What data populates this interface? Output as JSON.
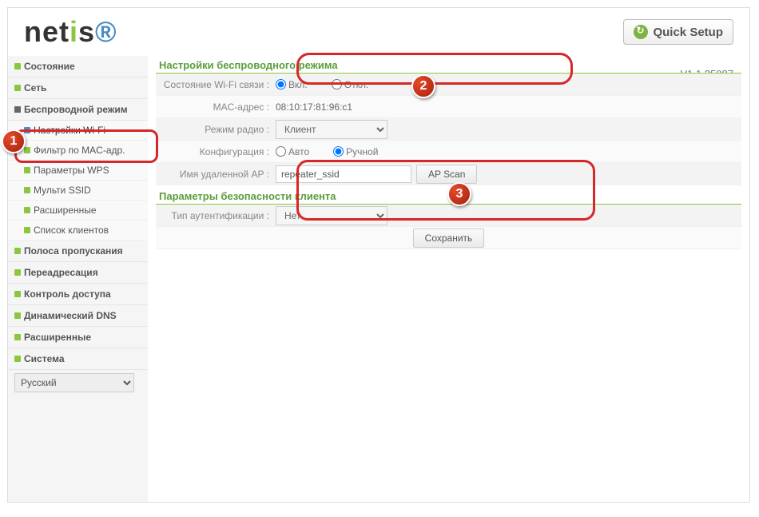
{
  "header": {
    "logo": "netis",
    "quick_setup": "Quick Setup",
    "version": "V1.1.25087"
  },
  "sidebar": {
    "items": [
      {
        "label": "Состояние"
      },
      {
        "label": "Сеть"
      },
      {
        "label": "Беспроводной режим",
        "expanded": true,
        "subs": [
          "Настройки Wi-Fi",
          "Фильтр по MAC-адр.",
          "Параметры WPS",
          "Мульти SSID",
          "Расширенные",
          "Список клиентов"
        ]
      },
      {
        "label": "Полоса пропускания"
      },
      {
        "label": "Переадресация"
      },
      {
        "label": "Контроль доступа"
      },
      {
        "label": "Динамический DNS"
      },
      {
        "label": "Расширенные"
      },
      {
        "label": "Система"
      }
    ],
    "language": "Русский"
  },
  "wireless": {
    "section_title": "Настройки беспроводного режима",
    "rows": {
      "state_label": "Состояние Wi-Fi связи :",
      "state_on": "Вкл.",
      "state_off": "Откл.",
      "mac_label": "MAC-адрес :",
      "mac_value": "08:10:17:81:96:c1",
      "radio_label": "Режим радио :",
      "radio_value": "Клиент",
      "config_label": "Конфигурация :",
      "config_auto": "Авто",
      "config_manual": "Ручной",
      "remote_label": "Имя удаленной AP :",
      "remote_value": "repeater_ssid",
      "apscan": "AP Scan"
    }
  },
  "security": {
    "section_title": "Параметры безопасности клиента",
    "auth_label": "Тип аутентификации :",
    "auth_value": "Нет",
    "save": "Сохранить"
  }
}
